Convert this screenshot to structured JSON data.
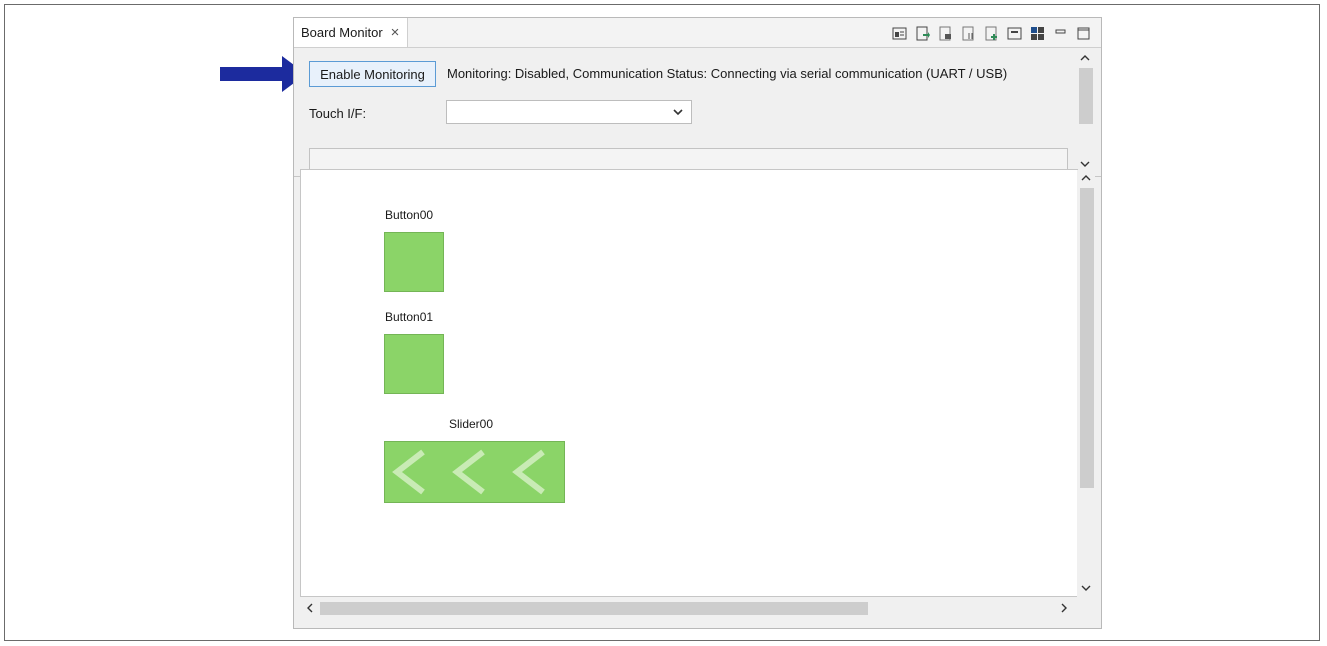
{
  "panel": {
    "tab_title": "Board Monitor",
    "tab_close": "×"
  },
  "toolbar": {
    "icons": [
      "show-view-icon",
      "export-icon",
      "layout-icon",
      "columns-icon",
      "add-icon",
      "panel-icon",
      "grid-icon",
      "minimize-icon",
      "maximize-icon"
    ]
  },
  "monitoring": {
    "button_label": "Enable Monitoring",
    "status": "Monitoring: Disabled, Communication Status: Connecting via serial communication (UART / USB)"
  },
  "touch_if": {
    "label": "Touch I/F:",
    "selected": ""
  },
  "progress": {
    "fraction": 0
  },
  "canvas": {
    "widgets": [
      {
        "name": "Button00",
        "type": "button"
      },
      {
        "name": "Button01",
        "type": "button"
      },
      {
        "name": "Slider00",
        "type": "slider"
      }
    ]
  },
  "colors": {
    "widget_fill": "#8bd468",
    "callout_arrow": "#1c2b9e",
    "button_highlight": "#5b9bd5"
  }
}
